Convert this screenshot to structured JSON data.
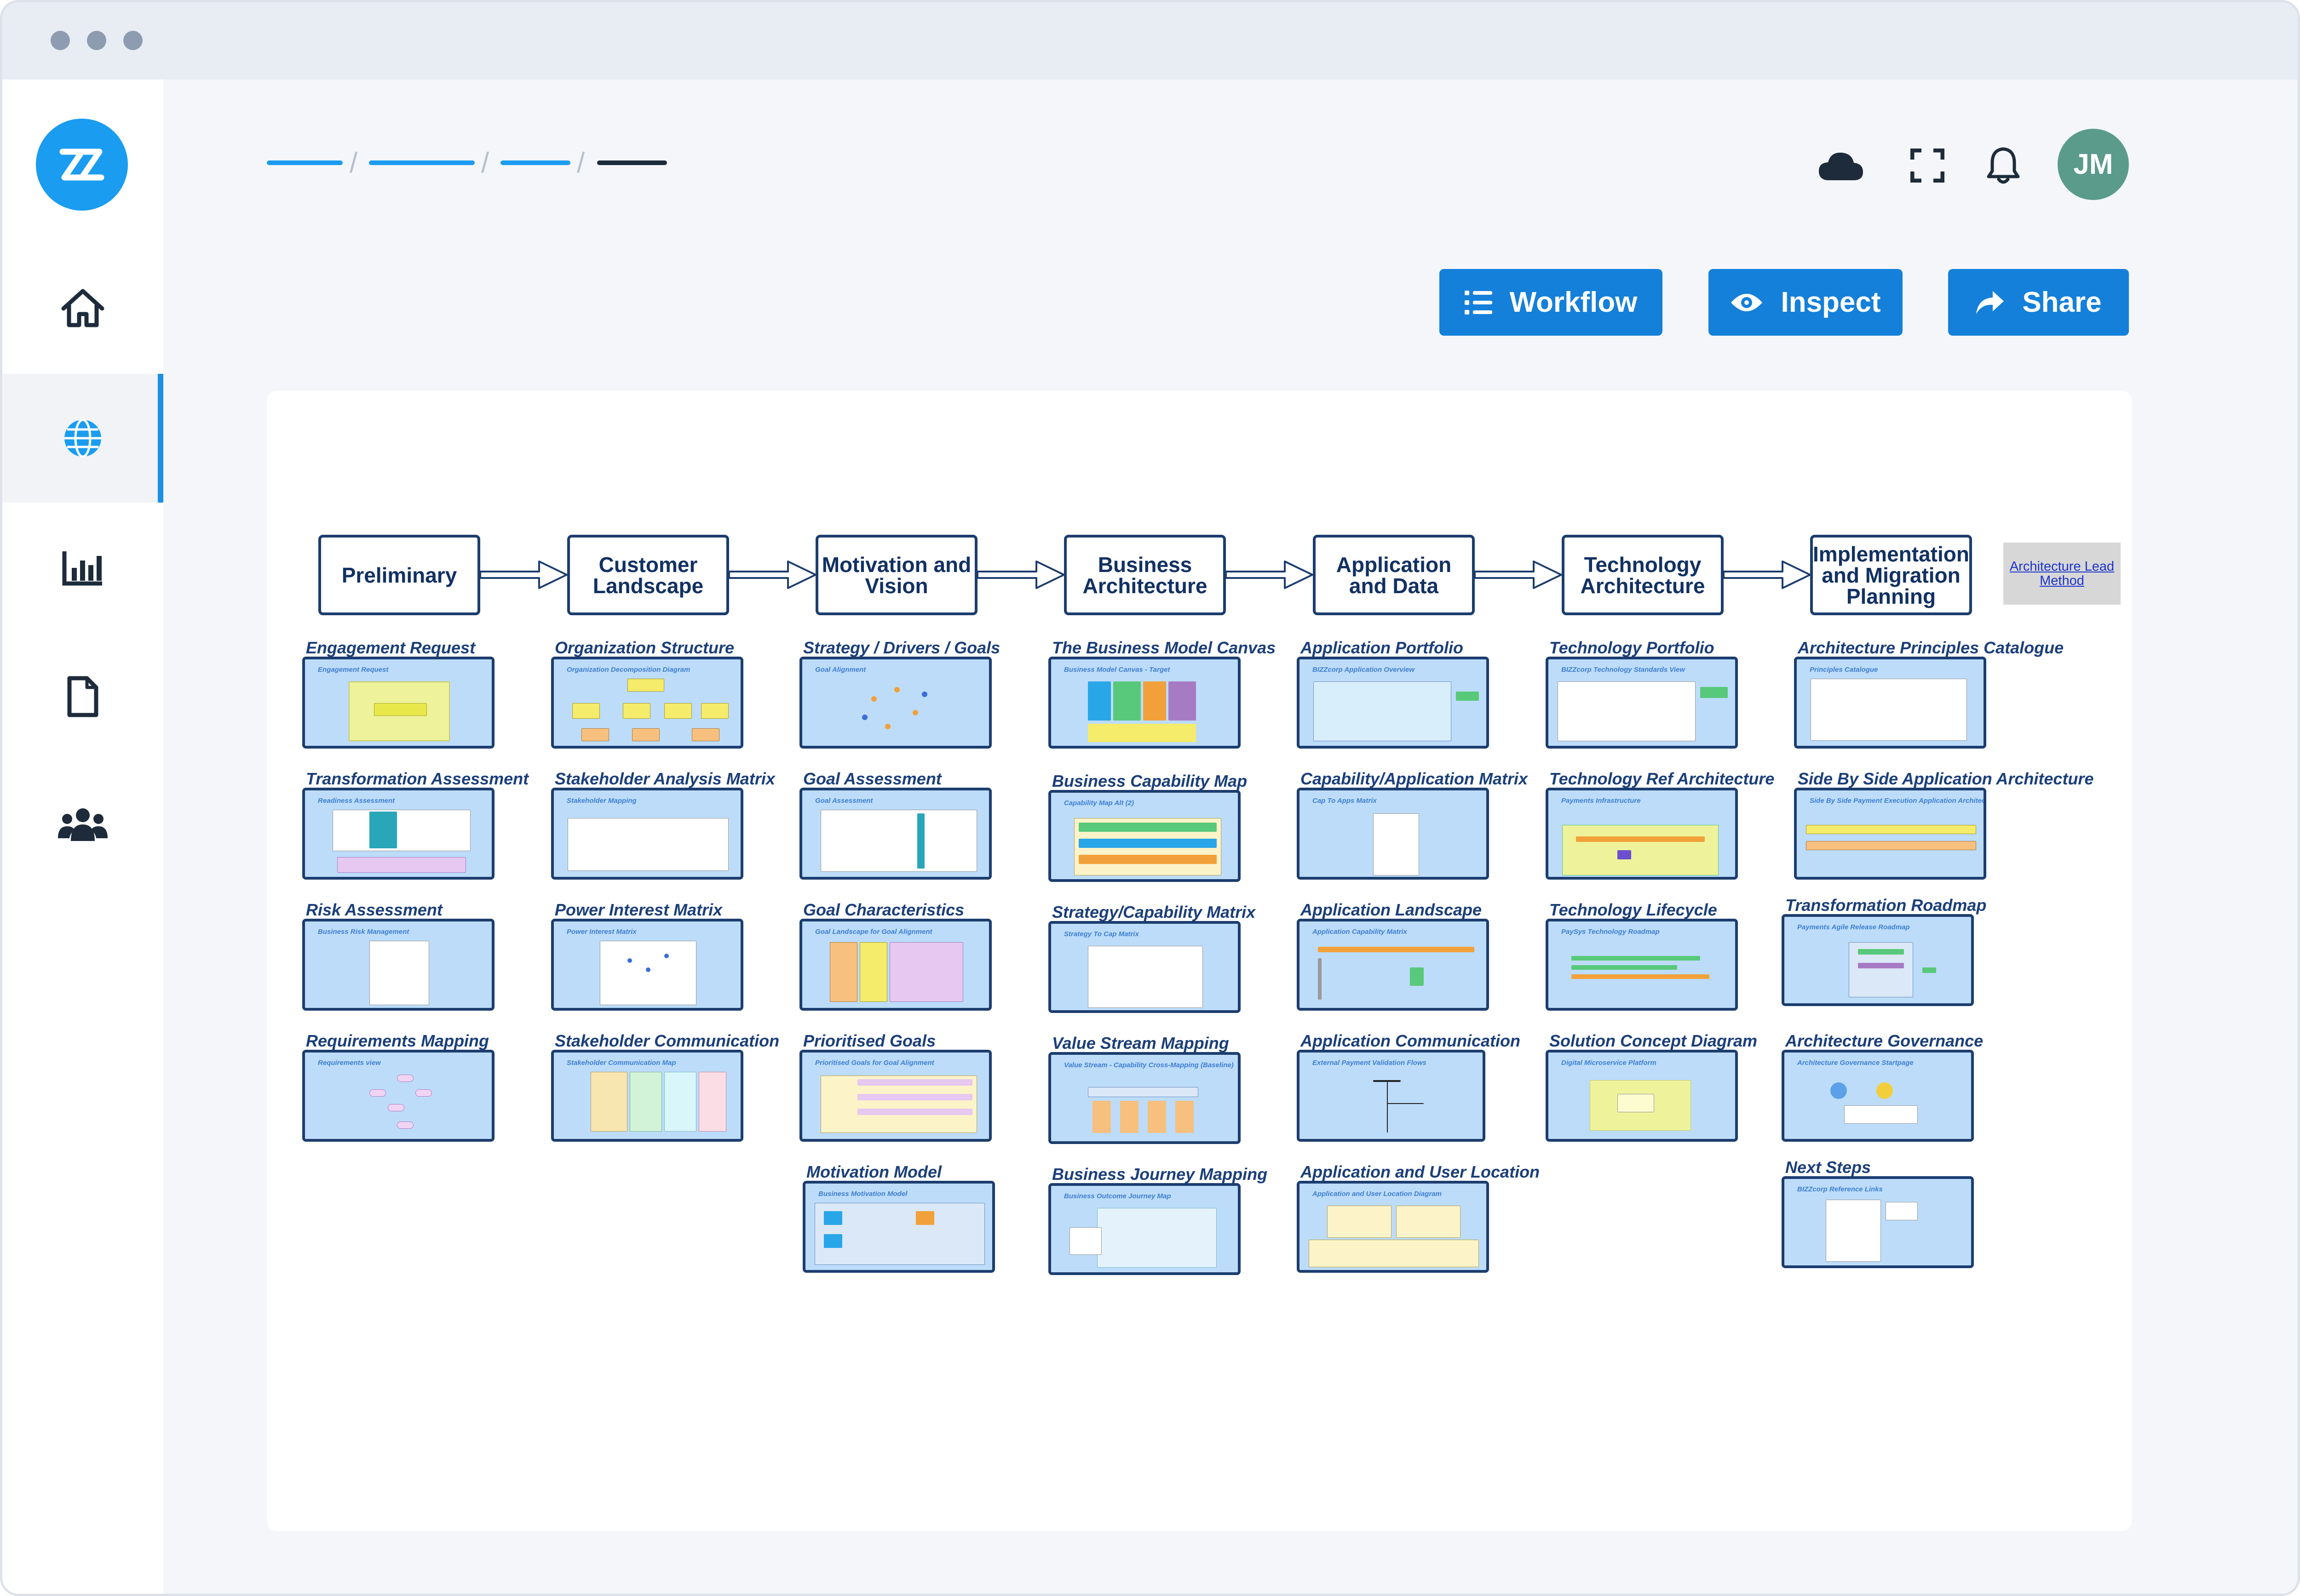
{
  "toolbar": {
    "workflow_label": "Workflow",
    "inspect_label": "Inspect",
    "share_label": "Share"
  },
  "user": {
    "initials": "JM"
  },
  "header_icons": [
    "cloud-icon",
    "fullscreen-icon",
    "bell-icon"
  ],
  "sidebar": {
    "logo_icon": "zz-logo",
    "items": [
      {
        "icon": "home-icon"
      },
      {
        "icon": "globe-icon",
        "active": true
      },
      {
        "icon": "bar-chart-icon"
      },
      {
        "icon": "document-icon"
      },
      {
        "icon": "users-icon"
      }
    ]
  },
  "colors": {
    "accent": "#1480da",
    "phase_border": "#1c3d6e",
    "thumbnail_fill": "#bcdcfa",
    "title_text": "#1b3f7a"
  },
  "diagram": {
    "phases": [
      "Preliminary",
      "Customer Landscape",
      "Motivation and Vision",
      "Business Architecture",
      "Application and Data",
      "Technology Architecture",
      "Implementation and Migration Planning"
    ],
    "reference_link": "Architecture Lead Method",
    "columns": [
      [
        {
          "title": "Engagement Request",
          "thumb": "Engagement Request"
        },
        {
          "title": "Transformation Assessment",
          "thumb": "Readiness Assessment"
        },
        {
          "title": "Risk Assessment",
          "thumb": "Business Risk Management"
        },
        {
          "title": "Requirements Mapping",
          "thumb": "Requirements view"
        }
      ],
      [
        {
          "title": "Organization Structure",
          "thumb": "Organization Decomposition Diagram"
        },
        {
          "title": "Stakeholder Analysis Matrix",
          "thumb": "Stakeholder Mapping"
        },
        {
          "title": "Power Interest Matrix",
          "thumb": "Power Interest Matrix"
        },
        {
          "title": "Stakeholder Communication",
          "thumb": "Stakeholder Communication Map"
        }
      ],
      [
        {
          "title": "Strategy / Drivers / Goals",
          "thumb": "Goal Alignment"
        },
        {
          "title": "Goal Assessment",
          "thumb": "Goal Assessment"
        },
        {
          "title": "Goal Characteristics",
          "thumb": "Goal Landscape for Goal Alignment"
        },
        {
          "title": "Prioritised Goals",
          "thumb": "Prioritised Goals for Goal Alignment"
        },
        {
          "title": "Motivation Model",
          "thumb": "Business Motivation Model"
        }
      ],
      [
        {
          "title": "The Business Model Canvas",
          "thumb": "Business Model Canvas - Target"
        },
        {
          "title": "Business Capability Map",
          "thumb": "Capability Map Alt (2)"
        },
        {
          "title": "Strategy/Capability Matrix",
          "thumb": "Strategy To Cap Matrix"
        },
        {
          "title": "Value Stream Mapping",
          "thumb": "Value Stream - Capability Cross-Mapping (Baseline)"
        },
        {
          "title": "Business Journey Mapping",
          "thumb": "Business Outcome Journey Map"
        }
      ],
      [
        {
          "title": "Application Portfolio",
          "thumb": "BIZZcorp Application Overview"
        },
        {
          "title": "Capability/Application Matrix",
          "thumb": "Cap To Apps Matrix"
        },
        {
          "title": "Application Landscape",
          "thumb": "Application Capability Matrix"
        },
        {
          "title": "Application Communication",
          "thumb": "External Payment Validation Flows"
        },
        {
          "title": "Application and User Location",
          "thumb": "Application and User Location Diagram"
        }
      ],
      [
        {
          "title": "Technology Portfolio",
          "thumb": "BIZZcorp Technology Standards View"
        },
        {
          "title": "Technology Ref Architecture",
          "thumb": "Payments Infrastructure"
        },
        {
          "title": "Technology Lifecycle",
          "thumb": "PaySys Technology Roadmap"
        },
        {
          "title": "Solution Concept Diagram",
          "thumb": "Digital Microservice Platform"
        }
      ],
      [
        {
          "title": "Architecture Principles Catalogue",
          "thumb": "Principles Catalogue"
        },
        {
          "title": "Side By Side Application Architecture",
          "thumb": "Side By Side Payment Execution Application Architecture"
        },
        {
          "title": "Transformation Roadmap",
          "thumb": "Payments Agile Release Roadmap"
        },
        {
          "title": "Architecture Governance",
          "thumb": "Architecture Governance Startpage"
        },
        {
          "title": "Next Steps",
          "thumb": "BIZZcorp Reference Links"
        }
      ]
    ]
  }
}
